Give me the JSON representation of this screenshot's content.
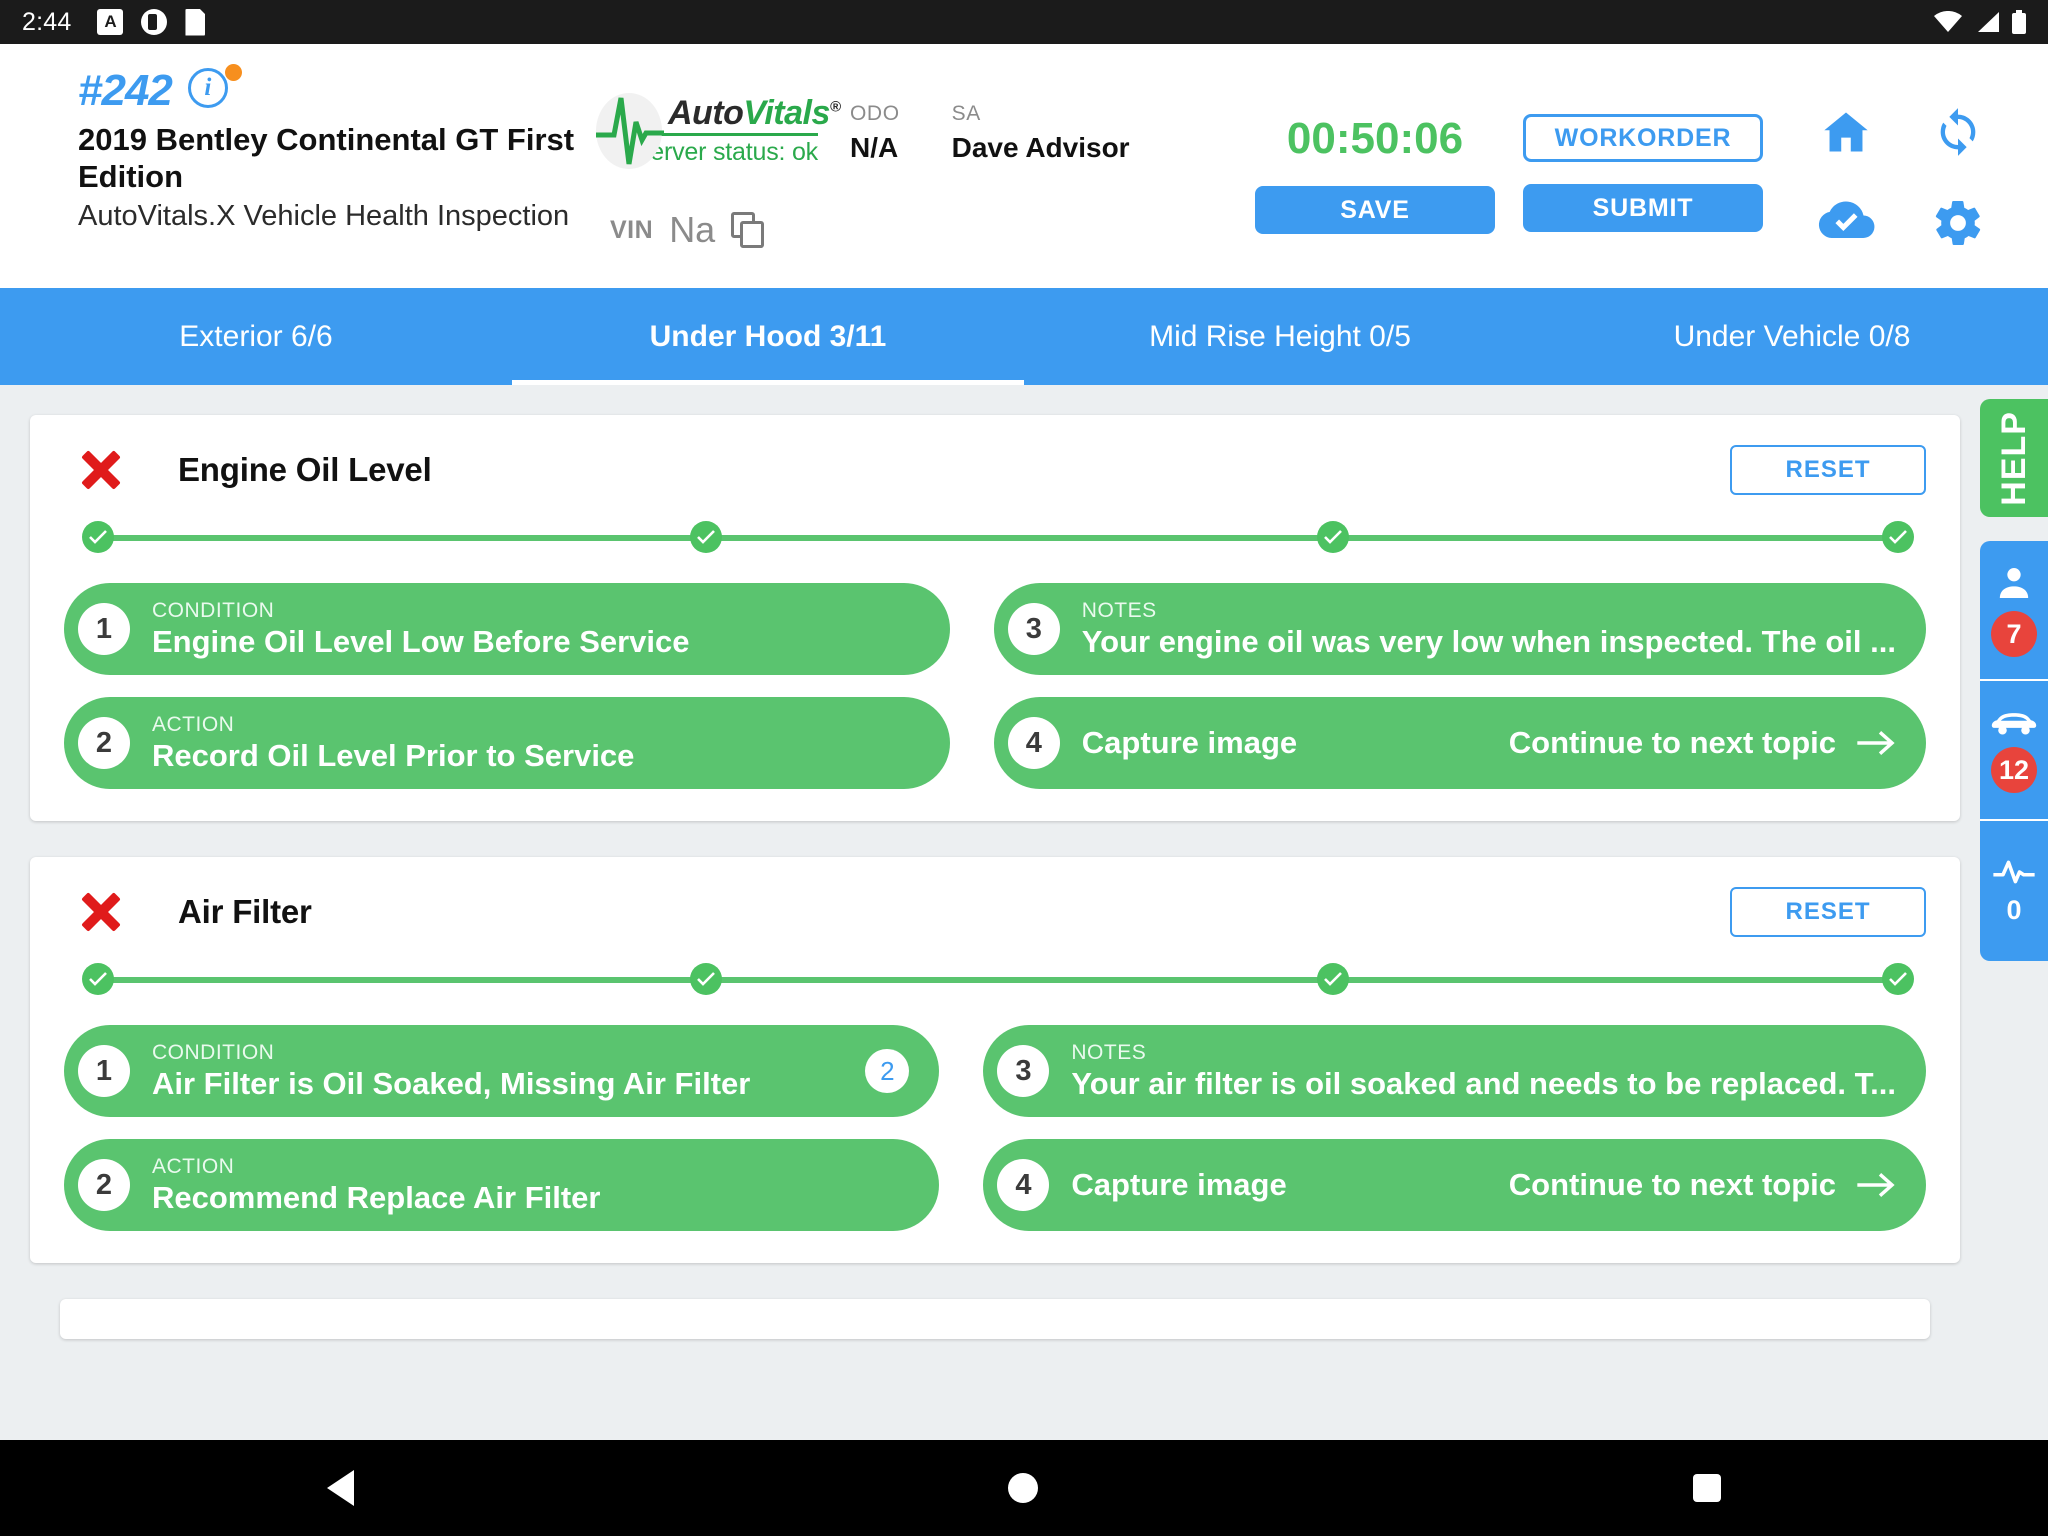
{
  "statusbar": {
    "time": "2:44",
    "icons": [
      "screenshot-icon",
      "app-icon",
      "sd-card-icon",
      "wifi-icon",
      "signal-icon",
      "battery-icon"
    ]
  },
  "header": {
    "order_id": "#242",
    "info_icon": "i",
    "vehicle": "2019 Bentley Continental GT First Edition",
    "form_name": "AutoVitals.X Vehicle Health Inspection",
    "logo": {
      "brand_auto": "Auto",
      "brand_vitals": "Vitals",
      "registered": "®",
      "server_status": "Server status: ok"
    },
    "odo_label": "ODO",
    "odo_value": "N/A",
    "sa_label": "SA",
    "sa_value": "Dave Advisor",
    "vin_label": "VIN",
    "vin_value": "Na",
    "timer": "00:50:06",
    "workorder_label": "WORKORDER",
    "save_label": "SAVE",
    "submit_label": "SUBMIT",
    "icons": [
      "home-icon",
      "sync-icon",
      "cloud-check-icon",
      "gear-icon"
    ],
    "accent_blue": "#3d9bf0",
    "accent_green": "#4cc261",
    "accent_orange": "#f78f1e"
  },
  "tabs": [
    {
      "label": "Exterior 6/6",
      "active": false
    },
    {
      "label": "Under Hood 3/11",
      "active": true
    },
    {
      "label": "Mid Rise Height 0/5",
      "active": false
    },
    {
      "label": "Under Vehicle 0/8",
      "active": false
    }
  ],
  "cards": [
    {
      "status_icon": "red-x-icon",
      "title": "Engine Oil Level",
      "reset_label": "RESET",
      "progress_nodes": 4,
      "items": [
        {
          "num": "1",
          "kicker": "CONDITION",
          "text": "Engine Oil Level Low Before Service",
          "badge": null
        },
        {
          "num": "3",
          "kicker": "NOTES",
          "text": "Your engine oil was very low when inspected. The oil ...",
          "badge": null
        },
        {
          "num": "2",
          "kicker": "ACTION",
          "text": "Record Oil Level Prior to Service",
          "badge": null
        },
        {
          "num": "4",
          "kicker": null,
          "text": "Capture image",
          "action": "Continue to next topic",
          "badge": null
        }
      ]
    },
    {
      "status_icon": "red-x-icon",
      "title": "Air Filter",
      "reset_label": "RESET",
      "progress_nodes": 4,
      "items": [
        {
          "num": "1",
          "kicker": "CONDITION",
          "text": "Air Filter is Oil Soaked, Missing Air Filter",
          "badge": "2"
        },
        {
          "num": "3",
          "kicker": "NOTES",
          "text": "Your air filter is oil soaked and needs to be replaced. T...",
          "badge": null
        },
        {
          "num": "2",
          "kicker": "ACTION",
          "text": "Recommend Replace Air Filter",
          "badge": null
        },
        {
          "num": "4",
          "kicker": null,
          "text": "Capture image",
          "action": "Continue to next topic",
          "badge": null
        }
      ]
    }
  ],
  "rail": {
    "help_label": "HELP",
    "items": [
      {
        "icon": "person-icon",
        "badge": "7"
      },
      {
        "icon": "car-icon",
        "badge": "12"
      },
      {
        "icon": "pulse-icon",
        "count": "0"
      }
    ]
  },
  "navbar": {
    "back": "back-button",
    "home": "home-button",
    "recents": "recents-button"
  }
}
